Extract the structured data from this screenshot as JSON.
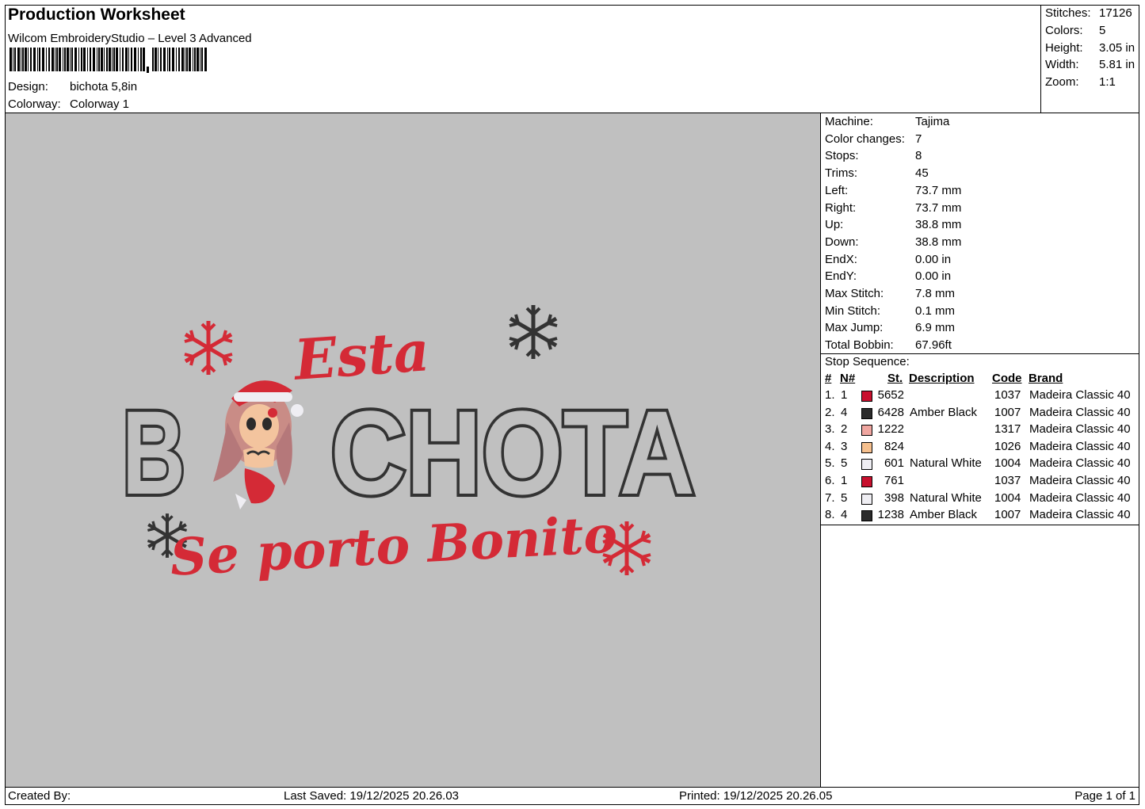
{
  "header": {
    "title": "Production Worksheet",
    "software": "Wilcom EmbroideryStudio – Level 3 Advanced",
    "design_label": "Design:",
    "design_value": "bichota 5,8in",
    "colorway_label": "Colorway:",
    "colorway_value": "Colorway 1"
  },
  "stats": {
    "stitches_label": "Stitches:",
    "stitches": "17126",
    "colors_label": "Colors:",
    "colors": "5",
    "height_label": "Height:",
    "height": "3.05 in",
    "width_label": "Width:",
    "width": "5.81 in",
    "zoom_label": "Zoom:",
    "zoom": "1:1"
  },
  "machine_info": [
    {
      "label": "Machine:",
      "value": "Tajima"
    },
    {
      "label": "Color changes:",
      "value": "7"
    },
    {
      "label": "Stops:",
      "value": "8"
    },
    {
      "label": "Trims:",
      "value": "45"
    },
    {
      "label": "Left:",
      "value": "73.7 mm"
    },
    {
      "label": "Right:",
      "value": "73.7 mm"
    },
    {
      "label": "Up:",
      "value": "38.8 mm"
    },
    {
      "label": "Down:",
      "value": "38.8 mm"
    },
    {
      "label": "EndX:",
      "value": "0.00 in"
    },
    {
      "label": "EndY:",
      "value": "0.00 in"
    },
    {
      "label": "Max Stitch:",
      "value": "7.8 mm"
    },
    {
      "label": "Min Stitch:",
      "value": "0.1 mm"
    },
    {
      "label": "Max Jump:",
      "value": "6.9 mm"
    },
    {
      "label": "Total Bobbin:",
      "value": "67.96ft"
    }
  ],
  "stop_sequence": {
    "title": "Stop Sequence:",
    "headers": {
      "num": "#",
      "n": "N#",
      "st": "St.",
      "description": "Description",
      "code": "Code",
      "brand": "Brand"
    },
    "rows": [
      {
        "num": "1.",
        "n": "1",
        "color": "#c8102e",
        "st": "5652",
        "description": "",
        "code": "1037",
        "brand": "Madeira Classic 40"
      },
      {
        "num": "2.",
        "n": "4",
        "color": "#2b2b2b",
        "st": "6428",
        "description": "Amber Black",
        "code": "1007",
        "brand": "Madeira Classic 40"
      },
      {
        "num": "3.",
        "n": "2",
        "color": "#f0a6a0",
        "st": "1222",
        "description": "",
        "code": "1317",
        "brand": "Madeira Classic 40"
      },
      {
        "num": "4.",
        "n": "3",
        "color": "#f6c08e",
        "st": "824",
        "description": "",
        "code": "1026",
        "brand": "Madeira Classic 40"
      },
      {
        "num": "5.",
        "n": "5",
        "color": "#efeef3",
        "st": "601",
        "description": "Natural White",
        "code": "1004",
        "brand": "Madeira Classic 40"
      },
      {
        "num": "6.",
        "n": "1",
        "color": "#c8102e",
        "st": "761",
        "description": "",
        "code": "1037",
        "brand": "Madeira Classic 40"
      },
      {
        "num": "7.",
        "n": "5",
        "color": "#efeef3",
        "st": "398",
        "description": "Natural White",
        "code": "1004",
        "brand": "Madeira Classic 40"
      },
      {
        "num": "8.",
        "n": "4",
        "color": "#2b2b2b",
        "st": "1238",
        "description": "Amber Black",
        "code": "1007",
        "brand": "Madeira Classic 40"
      }
    ]
  },
  "design_preview": {
    "line1": "Esta",
    "line2a": "B",
    "line2b": "CHOTA",
    "line3": "Se porto Bonito",
    "colors": {
      "red": "#d42a36",
      "black": "#333333",
      "background": "#c0c0c0"
    }
  },
  "footer": {
    "created_by": "Created By:",
    "last_saved": "Last Saved: 19/12/2025 20.26.03",
    "printed": "Printed: 19/12/2025 20.26.05",
    "page": "Page 1 of 1"
  }
}
